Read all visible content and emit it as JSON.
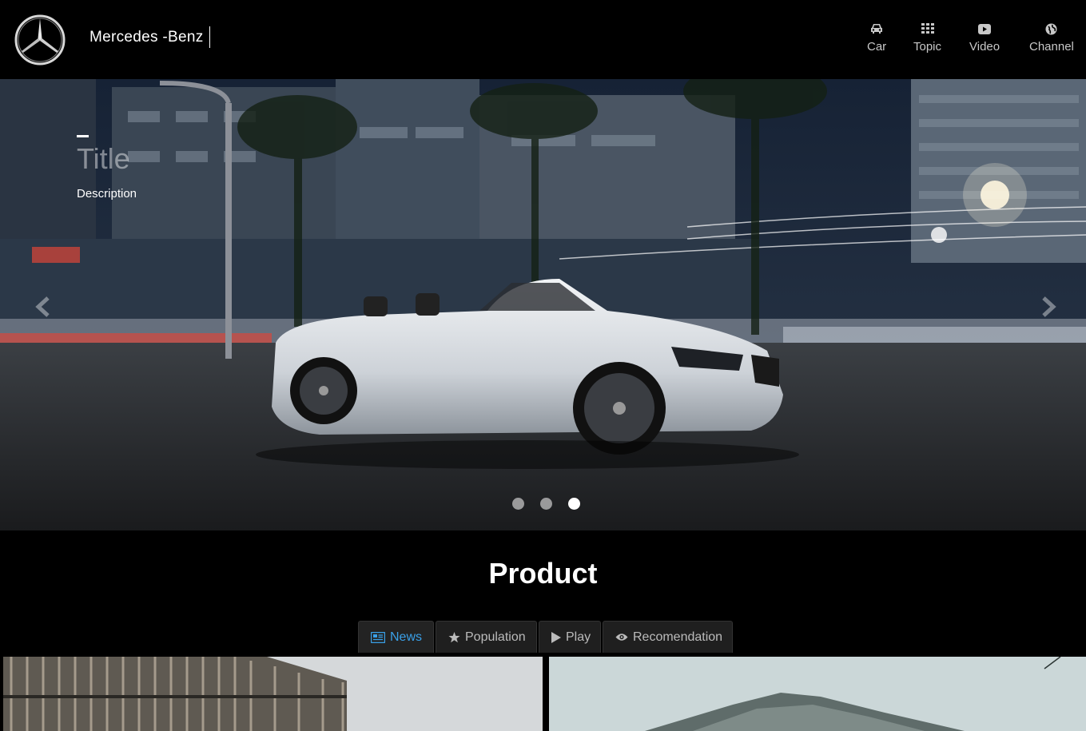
{
  "header": {
    "brand": "Mercedes -Benz",
    "nav": [
      {
        "label": "Car",
        "icon": "car-icon"
      },
      {
        "label": "Topic",
        "icon": "grid-icon"
      },
      {
        "label": "Video",
        "icon": "youtube-icon"
      },
      {
        "label": "Channel",
        "icon": "globe-icon"
      }
    ]
  },
  "hero": {
    "title": "Title",
    "description": "Description",
    "slide_count": 3,
    "active_slide": 3
  },
  "product": {
    "title": "Product",
    "tabs": [
      {
        "label": "News",
        "icon": "newspaper-icon",
        "active": true
      },
      {
        "label": "Population",
        "icon": "star-icon",
        "active": false
      },
      {
        "label": "Play",
        "icon": "play-icon",
        "active": false
      },
      {
        "label": "Recomendation",
        "icon": "eye-icon",
        "active": false
      }
    ]
  },
  "colors": {
    "background": "#000000",
    "active_tab": "#3aa0e8",
    "tab_bg": "#1f1f1f"
  }
}
